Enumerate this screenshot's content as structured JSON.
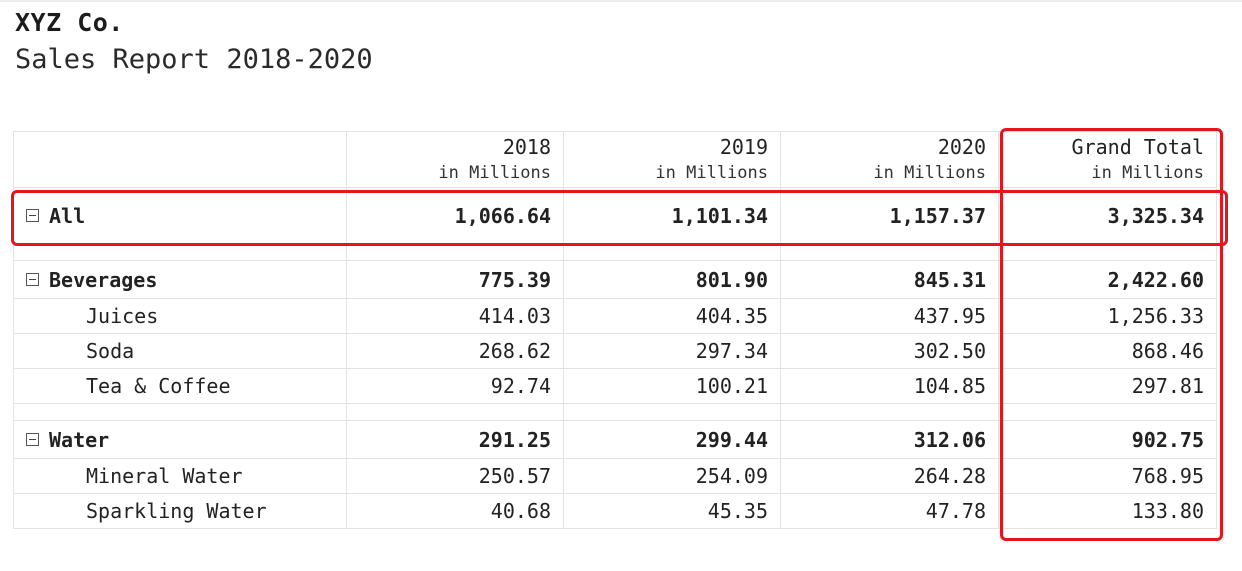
{
  "report": {
    "company": "XYZ Co.",
    "subtitle": "Sales Report 2018-2020"
  },
  "table": {
    "columns": [
      {
        "year": "2018",
        "unit": "in Millions"
      },
      {
        "year": "2019",
        "unit": "in Millions"
      },
      {
        "year": "2020",
        "unit": "in Millions"
      },
      {
        "year": "Grand Total",
        "unit": "in Millions"
      }
    ],
    "all": {
      "label": "All",
      "values": [
        "1,066.64",
        "1,101.34",
        "1,157.37",
        "3,325.34"
      ]
    },
    "groups": [
      {
        "label": "Beverages",
        "values": [
          "775.39",
          "801.90",
          "845.31",
          "2,422.60"
        ],
        "items": [
          {
            "label": "Juices",
            "values": [
              "414.03",
              "404.35",
              "437.95",
              "1,256.33"
            ]
          },
          {
            "label": "Soda",
            "values": [
              "268.62",
              "297.34",
              "302.50",
              "868.46"
            ]
          },
          {
            "label": "Tea & Coffee",
            "values": [
              "92.74",
              "100.21",
              "104.85",
              "297.81"
            ]
          }
        ]
      },
      {
        "label": "Water",
        "values": [
          "291.25",
          "299.44",
          "312.06",
          "902.75"
        ],
        "items": [
          {
            "label": "Mineral Water",
            "values": [
              "250.57",
              "254.09",
              "264.28",
              "768.95"
            ]
          },
          {
            "label": "Sparkling Water",
            "values": [
              "40.68",
              "45.35",
              "47.78",
              "133.80"
            ]
          }
        ]
      }
    ]
  },
  "highlight_color": "#e8141d"
}
